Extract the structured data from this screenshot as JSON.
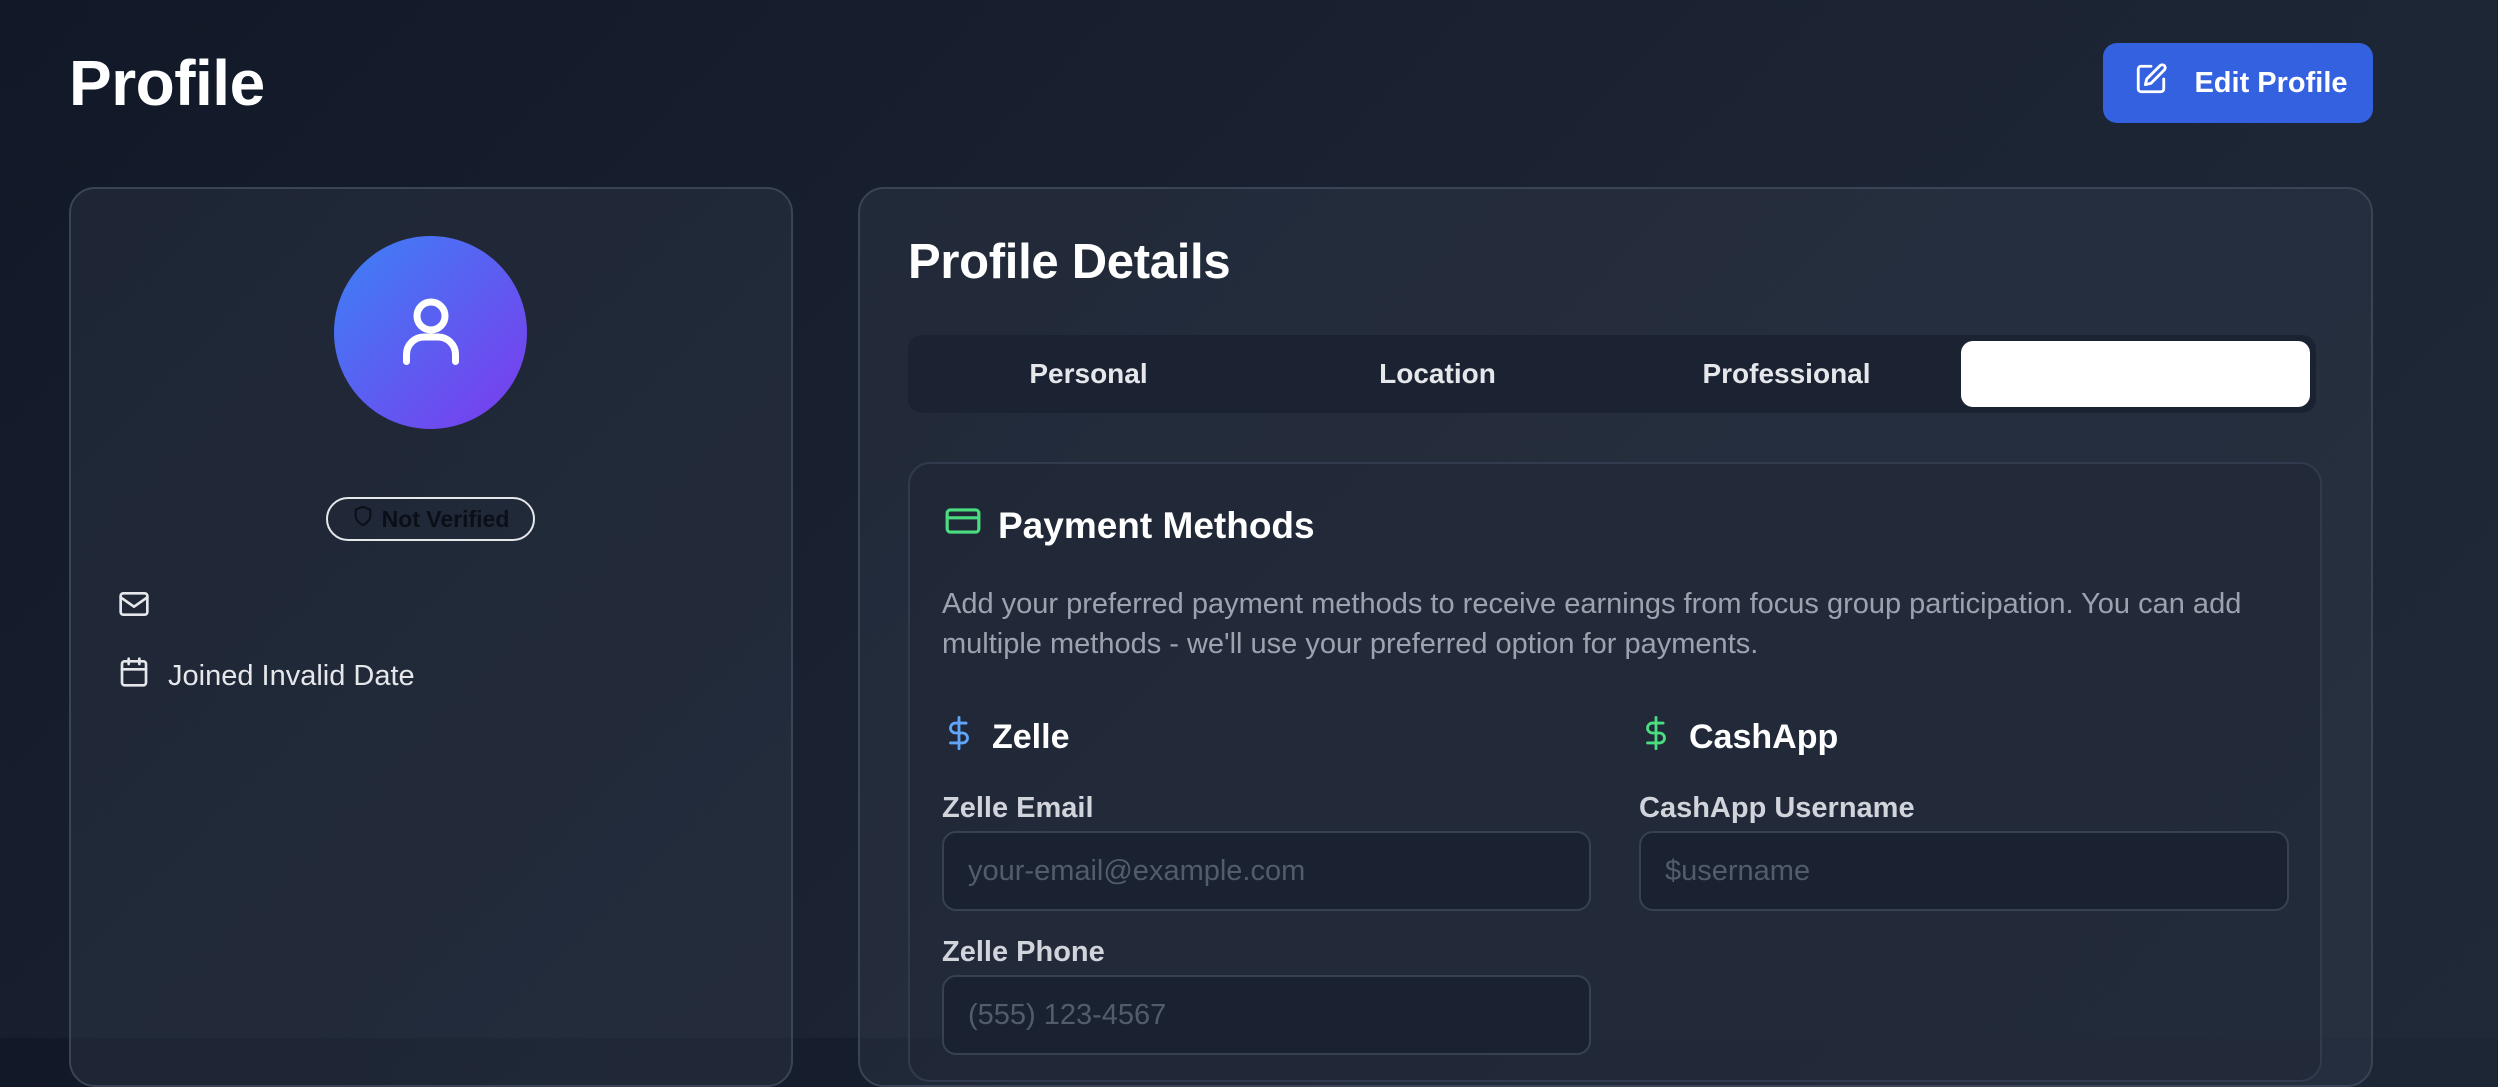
{
  "header": {
    "title": "Profile",
    "edit_button_label": "Edit Profile"
  },
  "sidebar_card": {
    "verification_badge": "Not Verified",
    "email": "",
    "joined_text": "Joined Invalid Date"
  },
  "details": {
    "title": "Profile Details",
    "tabs": [
      {
        "label": "Personal",
        "active": false
      },
      {
        "label": "Location",
        "active": false
      },
      {
        "label": "Professional",
        "active": false
      },
      {
        "label": "",
        "active": true
      }
    ]
  },
  "payment_methods": {
    "title": "Payment Methods",
    "description": "Add your preferred payment methods to receive earnings from focus group participation. You can add multiple methods - we'll use your preferred option for payments.",
    "zelle": {
      "title": "Zelle",
      "email_label": "Zelle Email",
      "email_placeholder": "your-email@example.com",
      "email_value": "",
      "phone_label": "Zelle Phone",
      "phone_placeholder": "(555) 123-4567",
      "phone_value": ""
    },
    "cashapp": {
      "title": "CashApp",
      "username_label": "CashApp Username",
      "username_placeholder": "$username",
      "username_value": ""
    }
  },
  "colors": {
    "accent_blue": "#3461e0",
    "avatar_gradient_start": "#3b82f6",
    "avatar_gradient_end": "#7c3aed",
    "payment_green": "#4ade80",
    "zelle_blue": "#60a5fa"
  },
  "icons": {
    "edit_button": "edit-square-icon",
    "avatar": "user-icon",
    "badge": "shield-icon",
    "email": "mail-icon",
    "joined": "calendar-icon",
    "payment": "credit-card-icon",
    "zelle": "dollar-icon",
    "cashapp": "dollar-icon"
  }
}
